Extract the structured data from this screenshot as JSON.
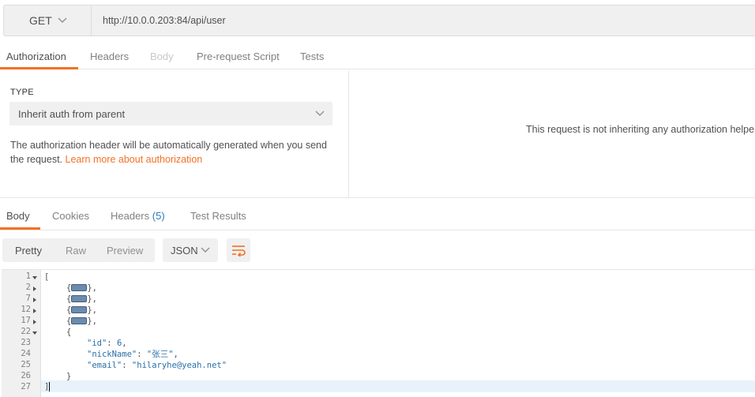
{
  "request": {
    "method": "GET",
    "url": "http://10.0.0.203:84/api/user"
  },
  "request_tabs": [
    {
      "label": "Authorization",
      "state": "active"
    },
    {
      "label": "Headers",
      "state": "normal"
    },
    {
      "label": "Body",
      "state": "disabled"
    },
    {
      "label": "Pre-request Script",
      "state": "normal"
    },
    {
      "label": "Tests",
      "state": "normal"
    }
  ],
  "auth": {
    "type_label": "TYPE",
    "type_value": "Inherit auth from parent",
    "description": "The authorization header will be automatically generated when you send the request. ",
    "link_text": "Learn more about authorization",
    "right_message": "This request is not inheriting any authorization helpe"
  },
  "response_tabs": [
    {
      "label": "Body",
      "count": "",
      "state": "active"
    },
    {
      "label": "Cookies",
      "count": "",
      "state": "normal"
    },
    {
      "label": "Headers",
      "count": "(5)",
      "state": "normal"
    },
    {
      "label": "Test Results",
      "count": "",
      "state": "normal"
    }
  ],
  "view_modes": {
    "pretty": "Pretty",
    "raw": "Raw",
    "preview": "Preview"
  },
  "format": "JSON",
  "colors": {
    "accent": "#f47023",
    "count_blue": "#2a7bbd",
    "code_blue": "#2a6fa8"
  },
  "icons": {
    "method_chevron": "chevron-down-icon",
    "type_chevron": "chevron-down-icon",
    "format_chevron": "chevron-down-icon",
    "wrap": "wrap-lines-icon"
  },
  "code": {
    "lines": [
      {
        "num": "1",
        "fold": "open"
      },
      {
        "num": "2",
        "fold": "closed"
      },
      {
        "num": "7",
        "fold": "closed"
      },
      {
        "num": "12",
        "fold": "closed"
      },
      {
        "num": "17",
        "fold": "closed"
      },
      {
        "num": "22",
        "fold": "open"
      },
      {
        "num": "23",
        "fold": ""
      },
      {
        "num": "24",
        "fold": ""
      },
      {
        "num": "25",
        "fold": ""
      },
      {
        "num": "26",
        "fold": ""
      },
      {
        "num": "27",
        "fold": ""
      }
    ],
    "open_bracket": "[",
    "close_bracket": "]",
    "collapsed_suffix": "},",
    "open_brace": "{",
    "close_brace": "}",
    "fields": [
      {
        "key": "\"id\"",
        "sep": ": ",
        "value": "6",
        "end": ","
      },
      {
        "key": "\"nickName\"",
        "sep": ": ",
        "value": "\"张三\"",
        "end": ","
      },
      {
        "key": "\"email\"",
        "sep": ": ",
        "value": "\"hilaryhe@yeah.net\"",
        "end": ""
      }
    ]
  }
}
